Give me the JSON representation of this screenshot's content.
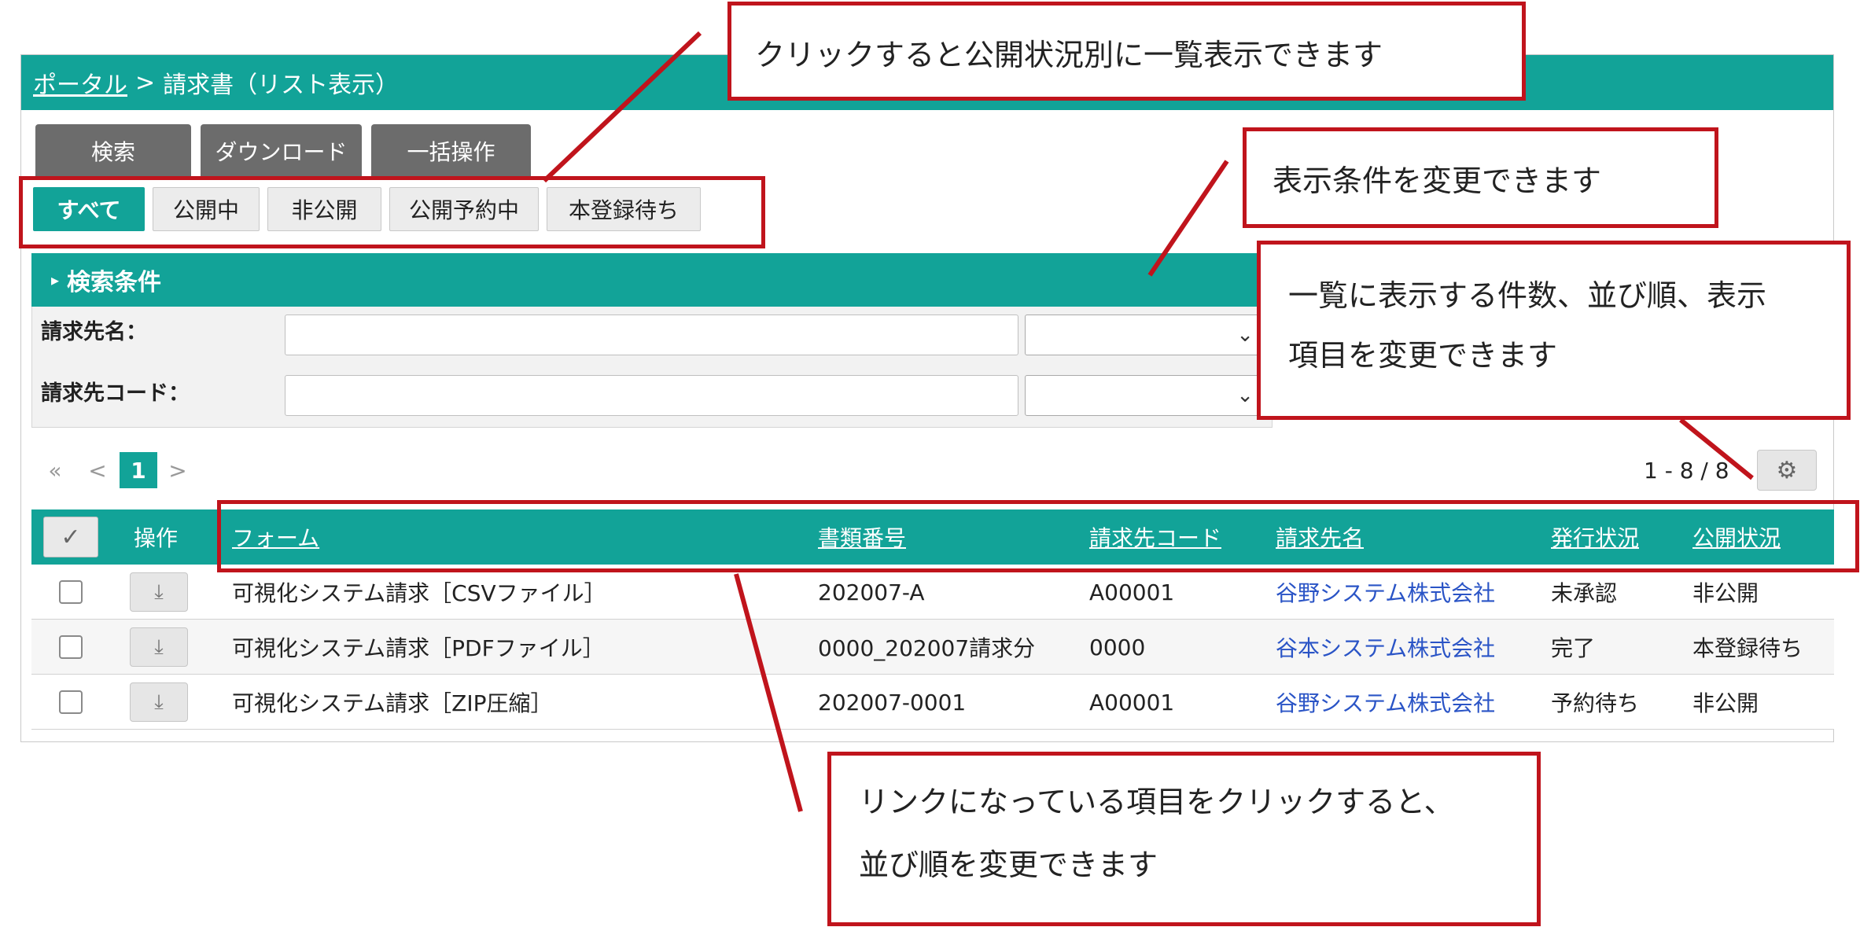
{
  "breadcrumb": {
    "home": "ポータル",
    "separator": ">",
    "current": "請求書（リスト表示）"
  },
  "top_tabs": [
    "検索",
    "ダウンロード",
    "一括操作"
  ],
  "filter_tabs": [
    {
      "label": "すべて",
      "active": true
    },
    {
      "label": "公開中",
      "active": false
    },
    {
      "label": "非公開",
      "active": false
    },
    {
      "label": "公開予約中",
      "active": false
    },
    {
      "label": "本登録待ち",
      "active": false
    }
  ],
  "search": {
    "header": "検索条件",
    "fields": [
      {
        "label": "請求先名：",
        "value": "",
        "select_value": ""
      },
      {
        "label": "請求先コード：",
        "value": "",
        "select_value": ""
      }
    ]
  },
  "pagination": {
    "first": "«",
    "prev": "<",
    "current": "1",
    "next": ">",
    "range": "1 - 8 / 8"
  },
  "table": {
    "columns": [
      "操作",
      "フォーム",
      "書類番号",
      "請求先コード",
      "請求先名",
      "発行状況",
      "公開状況"
    ],
    "rows": [
      {
        "form": "可視化システム請求［CSVファイル］",
        "doc_no": "202007-A",
        "code": "A00001",
        "name": "谷野システム株式会社",
        "issue": "未承認",
        "publish": "非公開"
      },
      {
        "form": "可視化システム請求［PDFファイル］",
        "doc_no": "0000_202007請求分",
        "code": "0000",
        "name": "谷本システム株式会社",
        "issue": "完了",
        "publish": "本登録待ち"
      },
      {
        "form": "可視化システム請求［ZIP圧縮］",
        "doc_no": "202007-0001",
        "code": "A00001",
        "name": "谷野システム株式会社",
        "issue": "予約待ち",
        "publish": "非公開"
      }
    ]
  },
  "callouts": {
    "filter": "クリックすると公開状況別に一覧表示できます",
    "search": "表示条件を変更できます",
    "settings_line1": "一覧に表示する件数、並び順、表示",
    "settings_line2": "項目を変更できます",
    "sort_line1": "リンクになっている項目をクリックすると、",
    "sort_line2": "並び順を変更できます"
  },
  "colors": {
    "accent": "#12a398",
    "callout_border": "#c0141c",
    "link": "#2a54c6"
  },
  "icons": {
    "settings": "gear-icon",
    "download": "download-icon",
    "check_all": "check-icon"
  }
}
